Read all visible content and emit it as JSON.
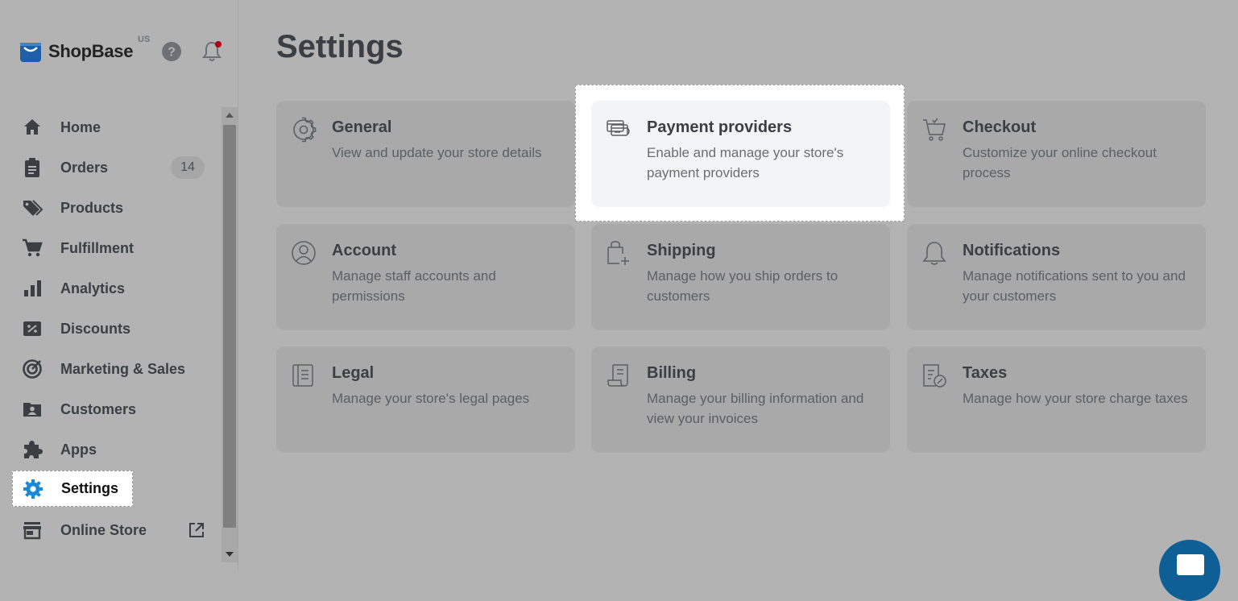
{
  "brand": {
    "name": "ShopBase",
    "region": "US"
  },
  "sidebar": {
    "items": [
      {
        "id": "home",
        "label": "Home",
        "icon": "home-icon"
      },
      {
        "id": "orders",
        "label": "Orders",
        "icon": "clipboard-icon",
        "badge": "14"
      },
      {
        "id": "products",
        "label": "Products",
        "icon": "tags-icon"
      },
      {
        "id": "fulfillment",
        "label": "Fulfillment",
        "icon": "cart-icon"
      },
      {
        "id": "analytics",
        "label": "Analytics",
        "icon": "bar-chart-icon"
      },
      {
        "id": "discounts",
        "label": "Discounts",
        "icon": "percent-ticket-icon"
      },
      {
        "id": "marketing",
        "label": "Marketing & Sales",
        "icon": "target-icon"
      },
      {
        "id": "customers",
        "label": "Customers",
        "icon": "contacts-folder-icon"
      },
      {
        "id": "apps",
        "label": "Apps",
        "icon": "puzzle-icon"
      },
      {
        "id": "settings",
        "label": "Settings",
        "icon": "gear-icon",
        "active": true
      },
      {
        "id": "online_store",
        "label": "Online Store",
        "icon": "storefront-icon"
      }
    ]
  },
  "main": {
    "title": "Settings",
    "cards": [
      {
        "title": "General",
        "desc": "View and update your store details",
        "icon": "gear-outline-icon"
      },
      {
        "title": "Payment providers",
        "desc": "Enable and manage your store's payment providers",
        "icon": "payment-cards-icon",
        "highlighted": true
      },
      {
        "title": "Checkout",
        "desc": "Customize your online checkout process",
        "icon": "shopping-cart-outline-icon"
      },
      {
        "title": "Account",
        "desc": "Manage staff accounts and permissions",
        "icon": "user-circle-icon"
      },
      {
        "title": "Shipping",
        "desc": "Manage how you ship orders to customers",
        "icon": "shopping-bag-plus-icon"
      },
      {
        "title": "Notifications",
        "desc": "Manage notifications sent to you and your customers",
        "icon": "bell-outline-icon"
      },
      {
        "title": "Legal",
        "desc": "Manage your store's legal pages",
        "icon": "document-icon"
      },
      {
        "title": "Billing",
        "desc": "Manage your billing information and view your invoices",
        "icon": "receipt-icon"
      },
      {
        "title": "Taxes",
        "desc": "Manage how your store charge taxes",
        "icon": "tax-document-icon"
      }
    ]
  },
  "colors": {
    "accent": "#0e5f96",
    "settings_icon": "#1a8ad8",
    "notification_dot": "#b00012"
  }
}
